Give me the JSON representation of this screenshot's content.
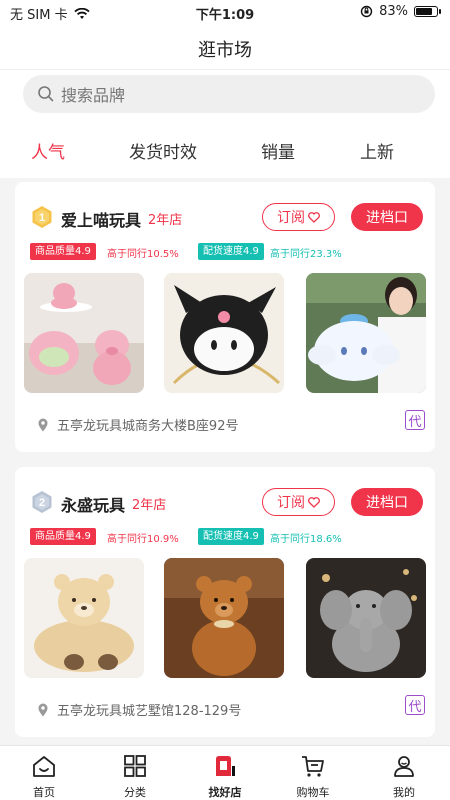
{
  "status_bar": {
    "carrier": "无 SIM 卡",
    "time": "下午1:09",
    "battery": "83%",
    "battery_level": 0.83
  },
  "header": {
    "title": "逛市场"
  },
  "search": {
    "placeholder": "搜索品牌"
  },
  "sort_tabs": [
    {
      "label": "人气",
      "active": true
    },
    {
      "label": "发货时效",
      "active": false
    },
    {
      "label": "销量",
      "active": false
    },
    {
      "label": "上新",
      "active": false
    }
  ],
  "shops": [
    {
      "rank": "1",
      "name": "爱上喵玩具",
      "years": "2年店",
      "subscribe_label": "订阅",
      "enter_label": "进档口",
      "quality_badge": "商品质量4.9",
      "quality_compare": "高于同行10.5%",
      "speed_badge": "配货速度4.9",
      "speed_compare": "高于同行23.3%",
      "address": "五亭龙玩具城商务大楼B座92号",
      "agent_tag": "代"
    },
    {
      "rank": "2",
      "name": "永盛玩具",
      "years": "2年店",
      "subscribe_label": "订阅",
      "enter_label": "进档口",
      "quality_badge": "商品质量4.9",
      "quality_compare": "高于同行10.9%",
      "speed_badge": "配货速度4.9",
      "speed_compare": "高于同行18.6%",
      "address": "五亭龙玩具城艺墅馆128-129号",
      "agent_tag": "代"
    }
  ],
  "bottom_nav": [
    {
      "label": "首页",
      "icon": "home-icon"
    },
    {
      "label": "分类",
      "icon": "category-icon"
    },
    {
      "label": "找好店",
      "icon": "shop-icon",
      "active": true
    },
    {
      "label": "购物车",
      "icon": "cart-icon"
    },
    {
      "label": "我的",
      "icon": "profile-icon"
    }
  ],
  "colors": {
    "accent": "#f0344a",
    "teal": "#15bfb2",
    "agent": "#9c4dcc"
  }
}
